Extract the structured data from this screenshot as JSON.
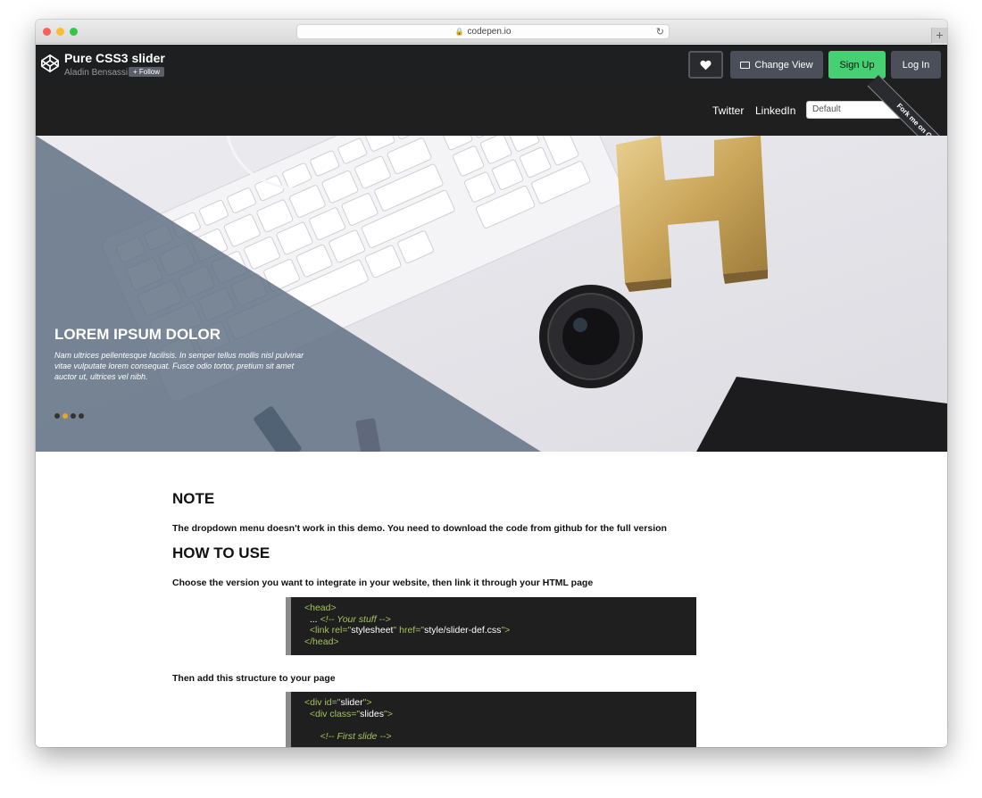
{
  "browser": {
    "url": "codepen.io"
  },
  "codepen": {
    "pen_title": "Pure CSS3 slider",
    "author": "Aladin Bensassi",
    "follow_label": "+ Follow",
    "change_view_label": "Change View",
    "signup_label": "Sign Up",
    "login_label": "Log In"
  },
  "demo_nav": {
    "links": [
      "Twitter",
      "LinkedIn"
    ],
    "select_value": "Default",
    "ribbon_label": "Fork me on GitHub"
  },
  "slider": {
    "title": "LOREM IPSUM DOLOR",
    "text": "Nam ultrices pellentesque facilisis. In semper tellus mollis nisl pulvinar vitae vulputate lorem consequat. Fusce odio tortor, pretium sit amet auctor ut, ultrices vel nibh.",
    "indicator_count": 4,
    "active_indicator": 2,
    "accent_color": "#e1a82a"
  },
  "content": {
    "note_heading": "NOTE",
    "note_text": "The dropdown menu doesn't work in this demo. You need to download the code from github for the full version",
    "howto_heading": "HOW TO USE",
    "choose_text": "Choose the version you want to integrate in your website, then link it through your HTML page",
    "then_text": "Then add this structure to your page",
    "code1": {
      "head_open": "<head>",
      "stuff_prefix": "... ",
      "stuff_comment": "<!-- Your stuff -->",
      "link_open": "<link rel=\"",
      "link_rel": "stylesheet",
      "link_mid": "\" href=\"",
      "link_href": "style/slider-def.css",
      "link_close": "\">",
      "head_close": "</head>"
    },
    "code2": {
      "div_open": "<div id=\"",
      "div_id": "slider",
      "div_open_close": "\">",
      "slides_open": "<div class=\"",
      "slides_class": "slides",
      "slides_open_close": "\">",
      "first_comment": "<!-- First slide -->"
    }
  }
}
